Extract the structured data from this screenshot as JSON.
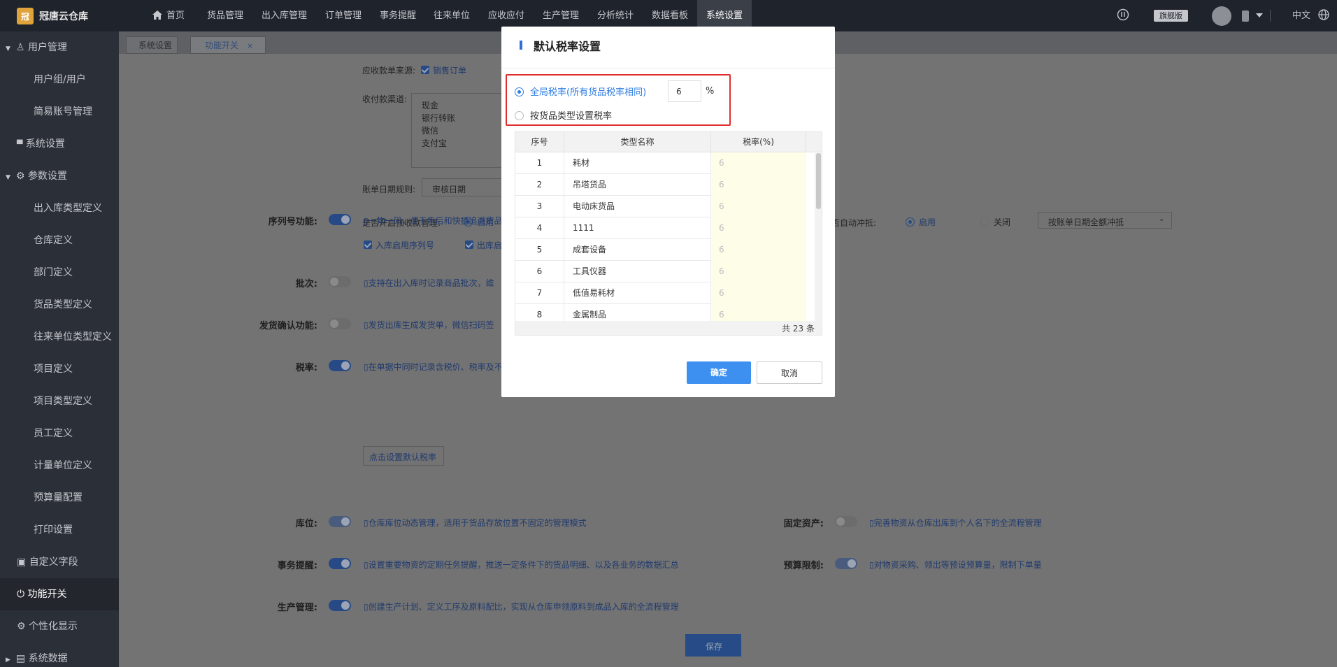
{
  "app": {
    "name": "冠唐云仓库",
    "logo_char": "冠"
  },
  "topnav": [
    "首页",
    "货品管理",
    "出入库管理",
    "订单管理",
    "事务提醒",
    "往来单位",
    "应收应付",
    "生产管理",
    "分析统计",
    "数据看板",
    "系统设置"
  ],
  "top_right": {
    "edition": "旗舰版",
    "lang": "中文"
  },
  "sidebar": [
    "用户管理",
    "用户组/用户",
    "简易账号管理",
    "系统设置",
    "参数设置",
    "出入库类型定义",
    "仓库定义",
    "部门定义",
    "货品类型定义",
    "往来单位类型定义",
    "项目定义",
    "项目类型定义",
    "员工定义",
    "计量单位定义",
    "预算量配置",
    "打印设置",
    "自定义字段",
    "功能开关",
    "个性化显示",
    "系统数据"
  ],
  "tabs": [
    "系统设置",
    "功能开关"
  ],
  "content": {
    "receivable_source_label": "应收款单来源:",
    "receivable_source_value": "销售订单",
    "payment_channels_label": "收付款渠道:",
    "payment_channels": [
      "现金",
      "银行转账",
      "微信",
      "支付宝"
    ],
    "bill_date_rule_label": "账单日期规则:",
    "bill_date_rule_value": "审核日期",
    "prepay_label": "是否开启预收款管理:",
    "prepay_value": "启用",
    "auto_offset_label": "是否自动冲抵:",
    "auto_offset_on": "启用",
    "auto_offset_off": "关闭",
    "auto_offset_select": "按账单日期全额冲抵",
    "serial_label": "序列号功能:",
    "serial_desc": "一物一码，便于售后和快捷追溯货品",
    "serial_in": "入库启用序列号",
    "serial_out": "出库启",
    "batch_label": "批次:",
    "batch_desc": "支持在出入库时记录商品批次，维",
    "ship_label": "发货确认功能:",
    "ship_desc": "发货出库生成发货单，微信扫码签",
    "tax_label": "税率:",
    "tax_desc": "在单据中同时记录含税价、税率及不含税价",
    "tax_button": "点击设置默认税率",
    "location_label": "库位:",
    "location_desc": "仓库库位动态管理，适用于货品存放位置不固定的管理模式",
    "fixed_asset_label": "固定资产:",
    "fixed_asset_desc": "完善物资从仓库出库到个人名下的全流程管理",
    "reminder_label": "事务提醒:",
    "reminder_desc": "设置重要物资的定期任务提醒，推送一定条件下的货品明细、以及各业务的数据汇总",
    "budget_label": "预算限制:",
    "budget_desc": "对物资采购、领出等预设预算量，限制下单量",
    "production_label": "生产管理:",
    "production_desc": "创建生产计划、定义工序及原料配比，实现从仓库申领原料到成品入库的全流程管理",
    "save_button": "保存"
  },
  "modal": {
    "title": "默认税率设置",
    "option_global": "全局税率(所有货品税率相同)",
    "global_rate": "6",
    "percent": "%",
    "option_by_type": "按货品类型设置税率",
    "columns": [
      "序号",
      "类型名称",
      "税率(%)"
    ],
    "rows": [
      {
        "no": "1",
        "name": "耗材",
        "rate": "6"
      },
      {
        "no": "2",
        "name": "吊塔货品",
        "rate": "6"
      },
      {
        "no": "3",
        "name": "电动床货品",
        "rate": "6"
      },
      {
        "no": "4",
        "name": "1111",
        "rate": "6"
      },
      {
        "no": "5",
        "name": "成套设备",
        "rate": "6"
      },
      {
        "no": "6",
        "name": "工具仪器",
        "rate": "6"
      },
      {
        "no": "7",
        "name": "低值易耗材",
        "rate": "6"
      },
      {
        "no": "8",
        "name": "金属制品",
        "rate": "6"
      }
    ],
    "total": "共 23 条",
    "confirm": "确定",
    "cancel": "取消"
  }
}
